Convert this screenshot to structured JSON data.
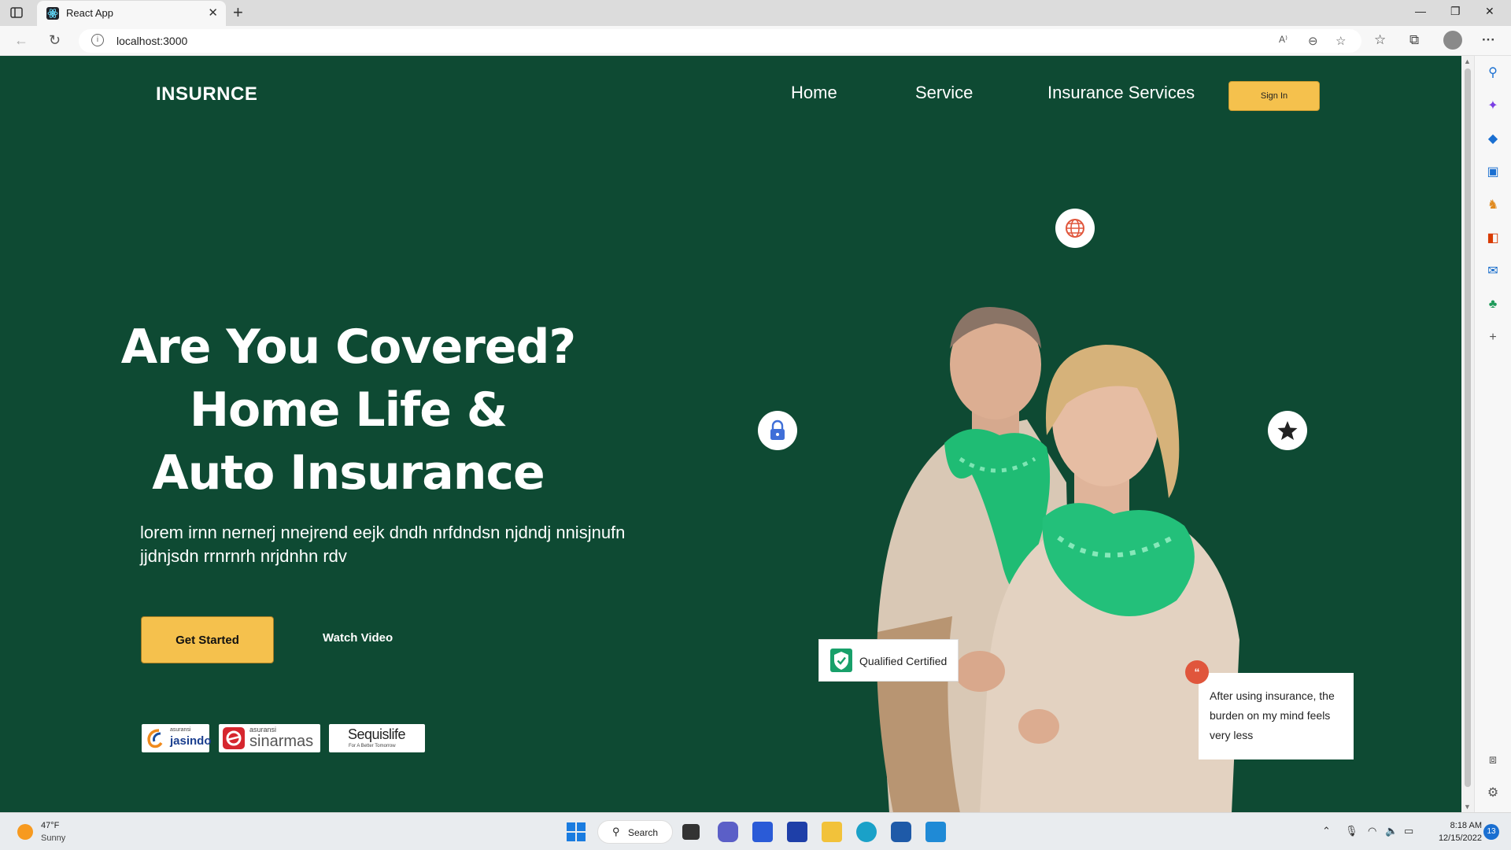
{
  "browser": {
    "tab_title": "React App",
    "url": "localhost:3000"
  },
  "nav": {
    "logo": "INSURNCE",
    "links": [
      "Home",
      "Service",
      "Insurance Services"
    ],
    "signin": "Sign In"
  },
  "hero": {
    "title_lines": [
      "Are You Covered?",
      "Home Life &",
      "Auto Insurance"
    ],
    "description": "lorem irnn nernerj nnejrend eejk dndh nrfdndsn njdndj nnisjnufn jjdnjsdn rrnrnrh nrjdnhn rdv",
    "primary_button": "Get Started",
    "secondary_button": "Watch Video"
  },
  "partners": [
    {
      "small": "asuransi",
      "big": "jasindo"
    },
    {
      "small": "asuransi",
      "big": "sinarmas"
    },
    {
      "big": "Sequislife",
      "small": "For A Better Tomorrow"
    }
  ],
  "badges": {
    "certified": "Qualified Certified",
    "quote_mark": "“",
    "testimonial": "After using insurance, the burden on my mind feels very less"
  },
  "taskbar": {
    "weather_temp": "47°F",
    "weather_cond": "Sunny",
    "search": "Search",
    "time": "8:18 AM",
    "date": "12/15/2022",
    "notifications": "13"
  },
  "colors": {
    "page_bg": "#0e4a33",
    "accent": "#f5c14d",
    "certified_green": "#18a06a",
    "quote_red": "#e0563c"
  }
}
